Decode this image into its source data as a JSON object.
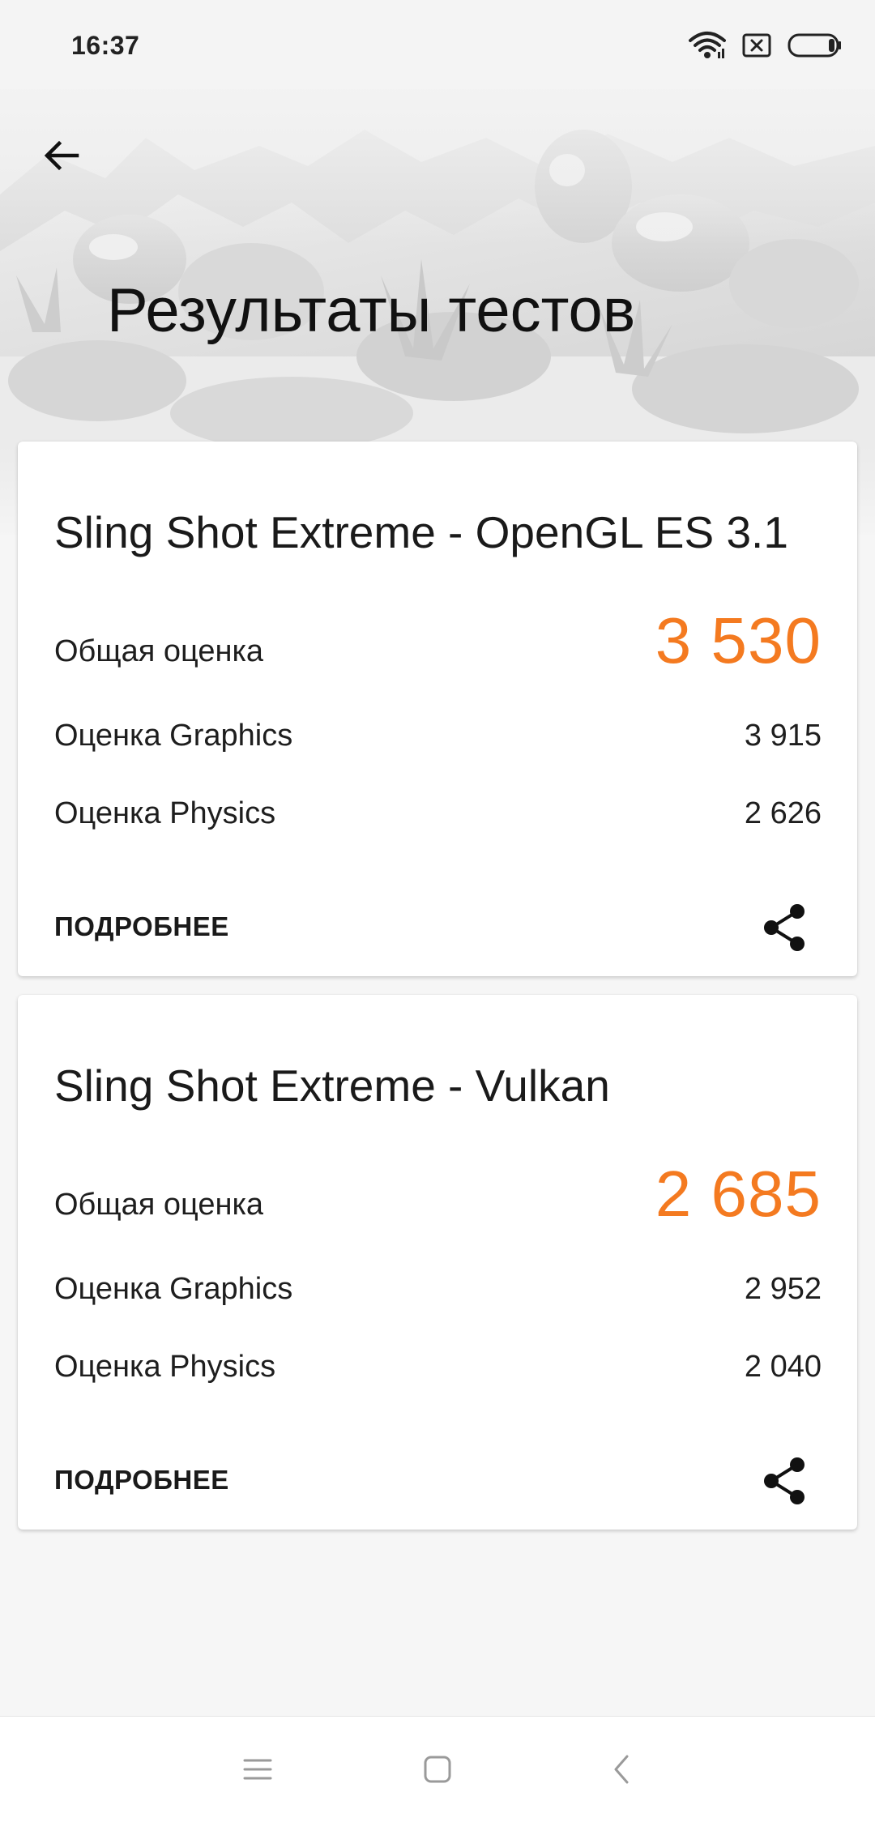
{
  "status_bar": {
    "time": "16:37"
  },
  "header": {
    "title": "Результаты тестов"
  },
  "results": [
    {
      "test_name": "Sling Shot Extreme - OpenGL ES 3.1",
      "overall_label": "Общая оценка",
      "overall_score": "3 530",
      "graphics_label": "Оценка Graphics",
      "graphics_score": "3 915",
      "physics_label": "Оценка Physics",
      "physics_score": "2 626",
      "details_label": "ПОДРОБНЕЕ"
    },
    {
      "test_name": "Sling Shot Extreme - Vulkan",
      "overall_label": "Общая оценка",
      "overall_score": "2 685",
      "graphics_label": "Оценка Graphics",
      "graphics_score": "2 952",
      "physics_label": "Оценка Physics",
      "physics_score": "2 040",
      "details_label": "ПОДРОБНЕЕ"
    }
  ],
  "icons": {
    "back": "back-arrow-icon",
    "share": "share-icon",
    "wifi": "wifi-icon",
    "sim": "no-sim-icon",
    "battery": "battery-icon",
    "nav_menu": "menu-icon",
    "nav_home": "home-square-icon",
    "nav_back": "nav-back-icon"
  },
  "colors": {
    "accent_score": "#f47a20",
    "background": "#f6f6f6",
    "card": "#ffffff"
  }
}
